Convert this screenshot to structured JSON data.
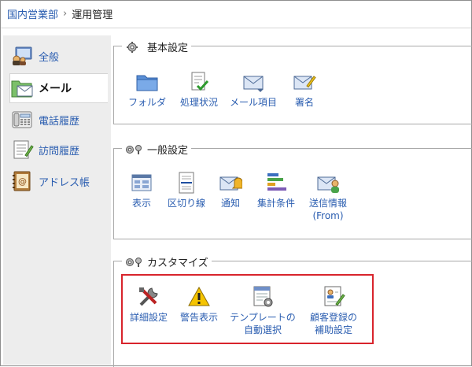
{
  "breadcrumb": {
    "parent": "国内営業部",
    "separator": "›",
    "current": "運用管理"
  },
  "sidebar": {
    "items": [
      {
        "label": "全般",
        "icon": "general-icon",
        "active": false
      },
      {
        "label": "メール",
        "icon": "mail-folder-icon",
        "active": true
      },
      {
        "label": "電話履歴",
        "icon": "phone-icon",
        "active": false
      },
      {
        "label": "訪問履歴",
        "icon": "notepad-icon",
        "active": false
      },
      {
        "label": "アドレス帳",
        "icon": "address-book-icon",
        "active": false
      }
    ]
  },
  "groups": {
    "basic": {
      "title": "基本設定",
      "icon": "gear-icon",
      "tools": [
        {
          "label": "フォルダ",
          "icon": "folder-icon"
        },
        {
          "label": "処理状況",
          "icon": "status-check-icon"
        },
        {
          "label": "メール項目",
          "icon": "mail-items-icon"
        },
        {
          "label": "署名",
          "icon": "signature-icon"
        }
      ]
    },
    "general": {
      "title": "一般設定",
      "icon": "gears-icon",
      "tools": [
        {
          "label": "表示",
          "icon": "display-icon"
        },
        {
          "label": "区切り線",
          "icon": "divider-line-icon"
        },
        {
          "label": "通知",
          "icon": "notification-icon"
        },
        {
          "label": "集計条件",
          "icon": "aggregate-conditions-icon"
        },
        {
          "label": "送信情報",
          "label2": "(From)",
          "icon": "sender-info-icon"
        }
      ]
    },
    "custom": {
      "title": "カスタマイズ",
      "icon": "gears-icon",
      "tools": [
        {
          "label": "詳細設定",
          "icon": "tools-icon"
        },
        {
          "label": "警告表示",
          "icon": "warning-icon"
        },
        {
          "label": "テンプレートの",
          "label2": "自動選択",
          "icon": "template-select-icon"
        },
        {
          "label": "顧客登録の",
          "label2": "補助設定",
          "icon": "customer-registration-icon"
        }
      ]
    }
  },
  "colors": {
    "link": "#2a5db0",
    "highlight": "#d8242c",
    "sidebar_bg": "#ededed"
  }
}
